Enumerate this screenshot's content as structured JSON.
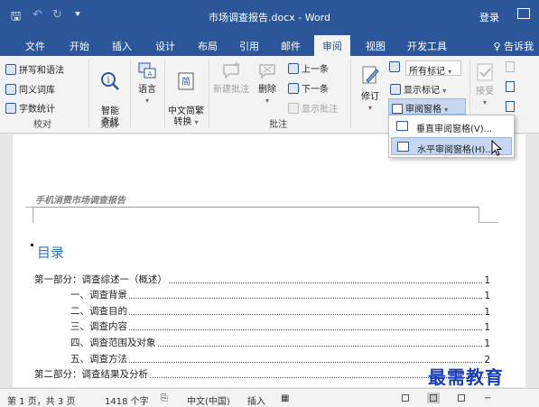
{
  "titlebar": {
    "title": "市场调查报告.docx - Word",
    "login": "登录"
  },
  "tabs": {
    "items": [
      "文件",
      "开始",
      "插入",
      "设计",
      "布局",
      "引用",
      "邮件",
      "审阅",
      "视图",
      "开发工具"
    ],
    "active": "审阅",
    "tellme": "♀ 告诉我"
  },
  "ribbon": {
    "proofing": {
      "spell": "拼写和语法",
      "thesaurus": "同义词库",
      "wordcount": "字数统计",
      "label": "校对"
    },
    "insights": {
      "smart_lookup": "智能\n查找",
      "label": "见解"
    },
    "language": {
      "btn": "语言"
    },
    "chinese": {
      "btn": "中文简繁\n转换"
    },
    "comments": {
      "new": "新建批注",
      "delete": "删除",
      "prev": "上一条",
      "next": "下一条",
      "show": "显示批注",
      "label": "批注"
    },
    "tracking": {
      "track": "修订",
      "markup_combo": "所有标记",
      "show_markup": "显示标记",
      "review_pane": "审阅窗格"
    },
    "changes": {
      "accept": "接受"
    }
  },
  "menu": {
    "items": [
      "垂直审阅窗格(V)...",
      "水平审阅窗格(H)..."
    ]
  },
  "doc": {
    "header": "手机消费市场调查报告",
    "toc_title": "目录",
    "toc": [
      {
        "text": "第一部分：调查综述一（概述）",
        "page": "1"
      },
      {
        "text": "一、调查背景",
        "page": "1"
      },
      {
        "text": "二、调查目的",
        "page": "1"
      },
      {
        "text": "三、调查内容",
        "page": "1"
      },
      {
        "text": "四、调查范围及对象",
        "page": "1"
      },
      {
        "text": "五、调查方法",
        "page": "2"
      },
      {
        "text": "第二部分：调查结果及分析",
        "page": ""
      }
    ]
  },
  "status": {
    "page": "第 1 页，共 3 页",
    "words": "1418 个字",
    "lang": "中文(中国)",
    "mode": "插入"
  },
  "watermark": "最需教育"
}
